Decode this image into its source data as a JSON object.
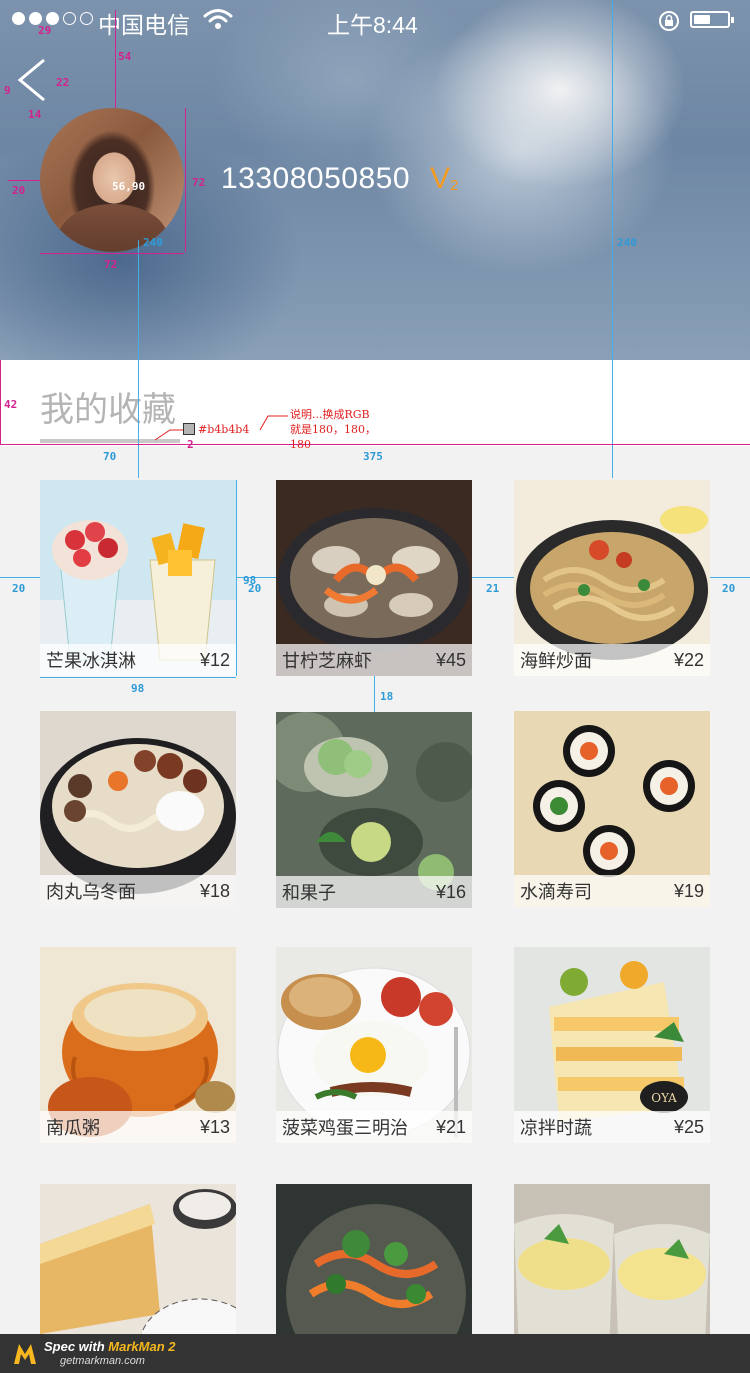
{
  "status_bar": {
    "carrier": "中国电信",
    "time": "上午8:44",
    "signal_dots": [
      true,
      true,
      true,
      false,
      false
    ]
  },
  "profile": {
    "phone": "13308050850",
    "vip_letter": "V",
    "vip_level": "2"
  },
  "favorites": {
    "title": "我的收藏",
    "items": [
      {
        "name": "芒果冰淇淋",
        "price": "¥12"
      },
      {
        "name": "甘柠芝麻虾",
        "price": "¥45"
      },
      {
        "name": "海鲜炒面",
        "price": "¥22"
      },
      {
        "name": "肉丸乌冬面",
        "price": "¥18"
      },
      {
        "name": "和果子",
        "price": "¥16"
      },
      {
        "name": "水滴寿司",
        "price": "¥19"
      },
      {
        "name": "南瓜粥",
        "price": "¥13"
      },
      {
        "name": "菠菜鸡蛋三明治",
        "price": "¥21"
      },
      {
        "name": "凉拌时蔬",
        "price": "¥25"
      }
    ]
  },
  "spec_annotations": {
    "m29": "29",
    "m54": "54",
    "m22": "22",
    "m9": "9",
    "m14": "14",
    "m20": "20",
    "m72a": "72",
    "m72b": "72",
    "coord": "56,90",
    "m240a": "240",
    "m240b": "240",
    "m42": "42",
    "color_swatch": "#b4b4b4",
    "m2": "2",
    "note_line1": "说明...换成RGB",
    "note_line2": "就是180，180，",
    "note_line3": "180",
    "m70": "70",
    "m375": "375",
    "c20a": "20",
    "c20b": "20",
    "c98a": "98",
    "c21": "21",
    "c20c": "20",
    "c98b": "98",
    "c18": "18"
  },
  "markman": {
    "line1_pre": "Spec with ",
    "line1_brand": "MarkMan 2",
    "line2": "getmarkman.com"
  }
}
